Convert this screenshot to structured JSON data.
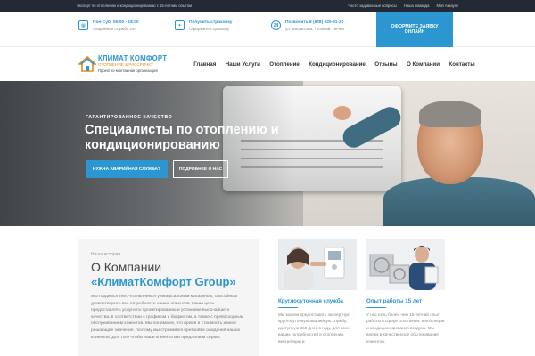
{
  "topbar": {
    "tagline": "Эксперт по отоплению и кондиционированию с 15-летним опытом",
    "links": [
      "Часто задаваемые вопросы",
      "Наша команда",
      "Мой Аккаунт"
    ]
  },
  "info": [
    {
      "icon": "calendar-icon",
      "title": "Пон-Суб: 09:00 - 18:00",
      "subtitle": "Аварийная служба 24ч"
    },
    {
      "icon": "certificate-icon",
      "title": "Получить страховку",
      "subtitle": "Оформите страховку"
    },
    {
      "icon": "phone-24-icon",
      "title": "Позвонить 8 (928) 020-31-20",
      "subtitle": "ул. Висаитова, Грозный, Чечня"
    }
  ],
  "order_button": "Оформите заявку онлайн",
  "logo": {
    "line1": "КЛИМАТ КОМФОРТ",
    "line2": "ОТОПЛЕНИЕ & РАССРОЧКУ",
    "line3": "Проектно-монтажная организация"
  },
  "nav": [
    "Главная",
    "Наши Услуги",
    "Отопление",
    "Кондиционирование",
    "Отзывы",
    "О Компании",
    "Контакты"
  ],
  "hero": {
    "kicker": "Гарантированное качество",
    "title": "Специалисты по отоплению и кондиционированию",
    "primary_button": "Нужна аварийная служба?",
    "secondary_button": "Подробнее о нас"
  },
  "about": {
    "subtitle": "Наша история",
    "heading": "О Компании",
    "brand": "«КлиматКомфорт Group»",
    "text": "Мы гордимся тем, что являемся универсальным магазином, способным удовлетворить все потребности наших клиентов. Наша цель — предоставлять услуги по проектированию и установке высочайшего качества, в соответствии с графиком и бюджетом, а также с превосходным обслуживанием клиентов. Мы понимаем, что время и стоимость имеют решающее значение, поэтому мы стремимся превзойти ожидания наших клиентов. Для того чтобы наши клиенты мы предлагаем сервис"
  },
  "cards": [
    {
      "title": "Круглосуточная служба",
      "text": "Мы можем предоставить экспертную круглосуточную аварийную службу, доступную 365 дней в году, для всех ваших потребностей в отоплении, вентиляции и"
    },
    {
      "title": "Опыт работы 15 лет",
      "text": "У нас есть более чем 15-летний опыт работы в сфере отопления, вентиляции и кондиционирования воздуха. Мы верим в качественное обслуживание клиентов."
    }
  ],
  "colors": {
    "accent": "#2b96cf",
    "orange": "#e58a1c",
    "topbar": "#242a33"
  }
}
